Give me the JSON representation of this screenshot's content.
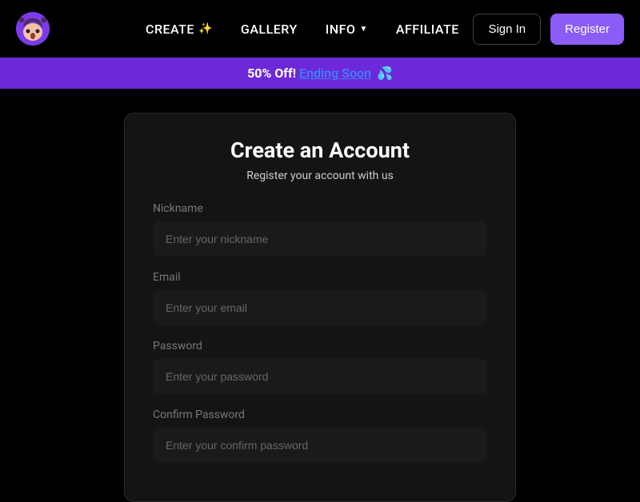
{
  "header": {
    "nav": {
      "create": "CREATE",
      "gallery": "GALLERY",
      "info": "INFO",
      "affiliate": "AFFILIATE"
    },
    "signin_label": "Sign In",
    "register_label": "Register"
  },
  "banner": {
    "prefix": "50% Off!",
    "link_text": "Ending Soon",
    "emoji": "💦"
  },
  "card": {
    "title": "Create an Account",
    "subtitle": "Register your account with us",
    "fields": {
      "nickname": {
        "label": "Nickname",
        "placeholder": "Enter your nickname"
      },
      "email": {
        "label": "Email",
        "placeholder": "Enter your email"
      },
      "password": {
        "label": "Password",
        "placeholder": "Enter your password"
      },
      "confirm_password": {
        "label": "Confirm Password",
        "placeholder": "Enter your confirm password"
      }
    }
  }
}
